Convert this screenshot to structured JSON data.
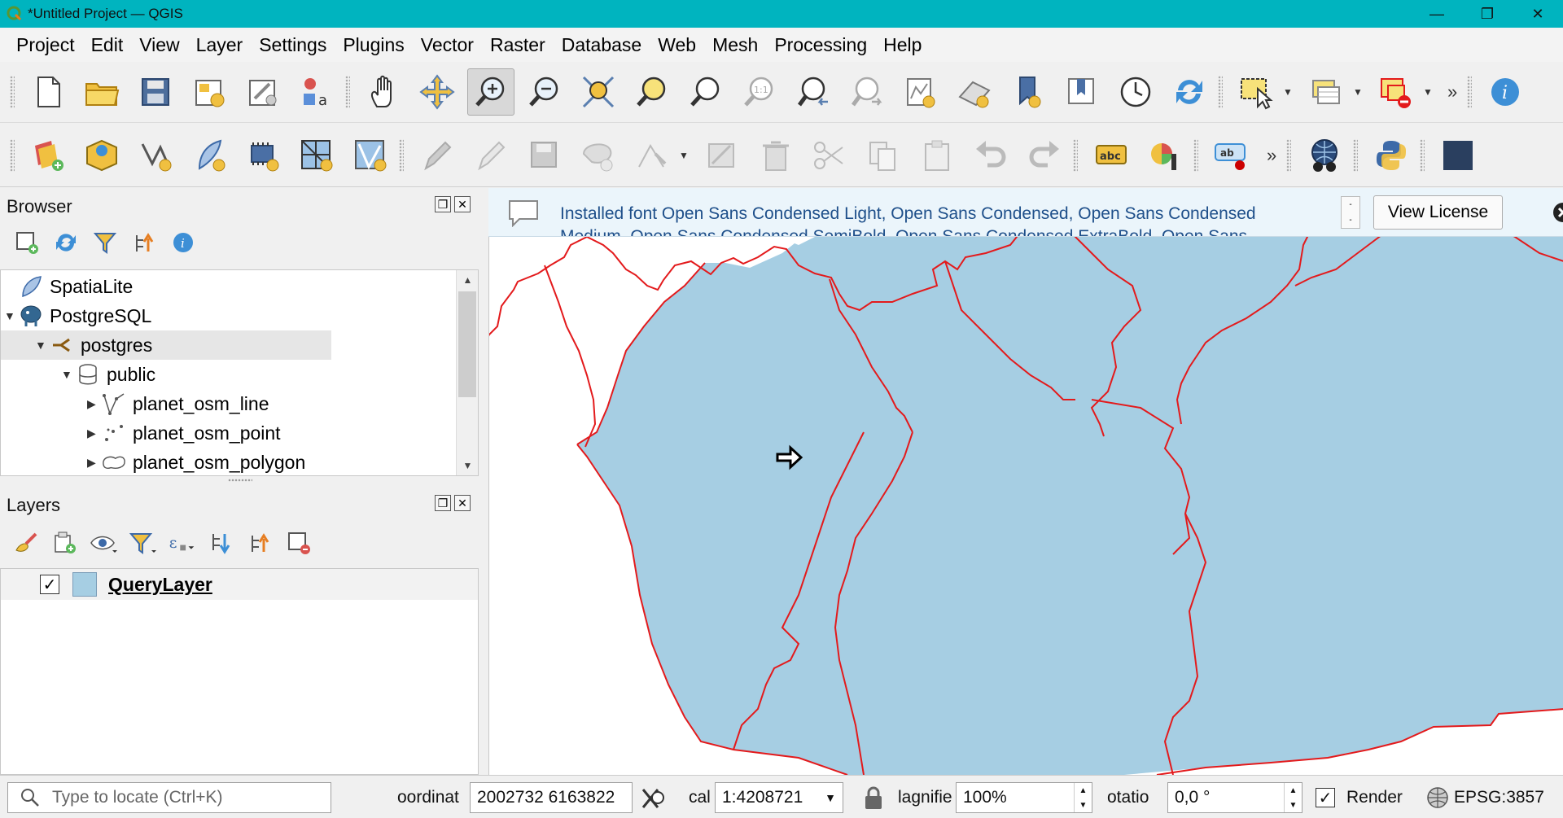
{
  "window": {
    "title": "*Untitled Project — QGIS",
    "controls": [
      "—",
      "❐",
      "✕"
    ]
  },
  "menu": [
    "Project",
    "Edit",
    "View",
    "Layer",
    "Settings",
    "Plugins",
    "Vector",
    "Raster",
    "Database",
    "Web",
    "Mesh",
    "Processing",
    "Help"
  ],
  "toolbar1": {
    "buttons": [
      "new-project",
      "open-project",
      "save-project",
      "print-layout",
      "layout-manager",
      "style-manager",
      "pan",
      "pan-to-selection",
      "zoom-in",
      "zoom-out",
      "zoom-full",
      "zoom-to-selection",
      "zoom-to-layer",
      "zoom-native",
      "zoom-last",
      "zoom-next",
      "new-map-view",
      "new-3d-view",
      "new-bookmark",
      "show-bookmarks",
      "temporal-controller",
      "refresh",
      "select-features",
      "open-attribute-table",
      "deselect-all"
    ],
    "overflow": "»"
  },
  "toolbar2": {
    "buttons": [
      "data-source-manager",
      "new-geopackage-layer",
      "new-virtual-layer",
      "new-spatialite-layer",
      "new-gpx-layer",
      "new-mesh-layer",
      "new-temporary-scratch-layer",
      "current-edits",
      "toggle-editing",
      "save-edits",
      "digitize-polygon",
      "vertex-tool",
      "modify-attributes",
      "delete-selected",
      "cut-features",
      "copy-features",
      "paste-features",
      "undo",
      "redo",
      "label-tool",
      "diagram-tool",
      "annotation-tool",
      "overflow",
      "metasearch",
      "python-console"
    ],
    "overflow": "»"
  },
  "browser": {
    "title": "Browser",
    "items": [
      {
        "label": "SpatiaLite",
        "icon": "feather-icon",
        "level": 0,
        "arrow": ""
      },
      {
        "label": "PostgreSQL",
        "icon": "elephant-icon",
        "level": 0,
        "arrow": "▼"
      },
      {
        "label": "postgres",
        "icon": "connection-icon",
        "level": 1,
        "arrow": "▼"
      },
      {
        "label": "public",
        "icon": "database-icon",
        "level": 2,
        "arrow": "▼"
      },
      {
        "label": "planet_osm_line",
        "icon": "line-layer-icon",
        "level": 3,
        "arrow": "▶"
      },
      {
        "label": "planet_osm_point",
        "icon": "point-layer-icon",
        "level": 3,
        "arrow": "▶"
      },
      {
        "label": "planet_osm_polygon",
        "icon": "polygon-layer-icon",
        "level": 3,
        "arrow": "▶"
      }
    ]
  },
  "layers": {
    "title": "Layers",
    "items": [
      {
        "label": "QueryLayer",
        "checked": true,
        "swatch": "#a6cee3"
      }
    ]
  },
  "message": {
    "text_line1": "Installed font Open Sans Condensed Light, Open Sans Condensed, Open Sans Condensed",
    "text_line2": "Medium, Open Sans Condensed SemiBold, Open Sans Condensed ExtraBold, Open Sans",
    "button": "View License"
  },
  "map": {
    "fill": "#a6cee3",
    "stroke": "#e31a1c"
  },
  "statusbar": {
    "locator_placeholder": "Type to locate (Ctrl+K)",
    "coordinate_label": "oordinat",
    "coordinate_value": "2002732 6163822",
    "scale_label": "cal",
    "scale_value": "1:4208721",
    "magnifier_label": "lagnifie",
    "magnifier_value": "100%",
    "rotation_label": "otatio",
    "rotation_value": "0,0 °",
    "render_label": "Render",
    "crs": "EPSG:3857"
  }
}
